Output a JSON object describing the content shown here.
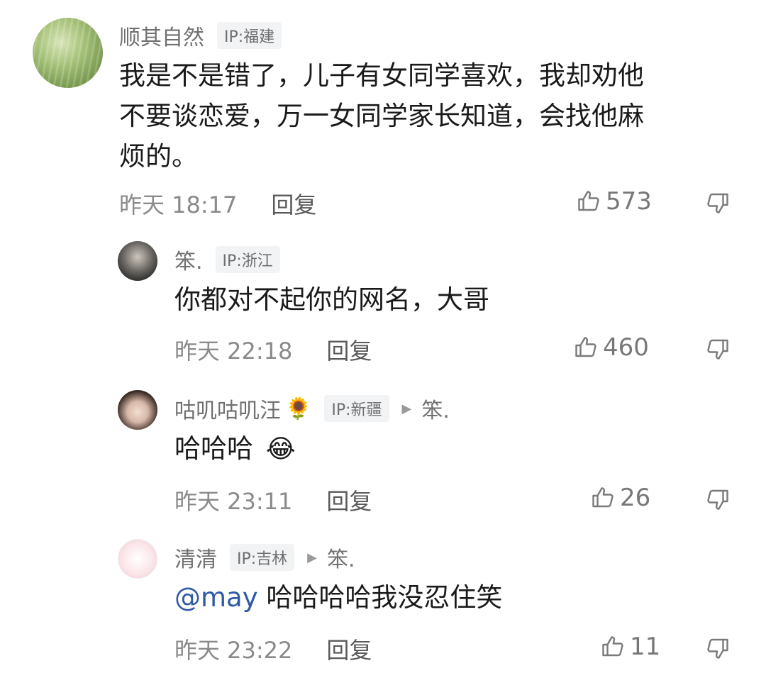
{
  "comments": [
    {
      "username": "顺其自然",
      "ip": "IP:福建",
      "lines": [
        "我是不是错了，儿子有女同学喜欢，我却劝他",
        "不要谈恋爱，万一女同学家长知道，会找他麻",
        "烦的。"
      ],
      "time": "昨天 18:17",
      "reply_label": "回复",
      "likes": "573"
    },
    {
      "username": "笨.",
      "ip": "IP:浙江",
      "text": "你都对不起你的网名，大哥",
      "time": "昨天 22:18",
      "reply_label": "回复",
      "likes": "460"
    },
    {
      "username": "咕叽咕叽汪",
      "name_emoji": "🌻",
      "ip": "IP:新疆",
      "reply_to": "笨.",
      "text": "哈哈哈",
      "text_emoji": "😂",
      "time": "昨天 23:11",
      "reply_label": "回复",
      "likes": "26"
    },
    {
      "username": "清清",
      "ip": "IP:吉林",
      "reply_to": "笨.",
      "mention": "@may",
      "text": " 哈哈哈哈我没忍住笑",
      "time": "昨天 23:22",
      "reply_label": "回复",
      "likes": "11"
    }
  ],
  "icons": {
    "like": "thumbs-up-icon",
    "dislike": "thumbs-down-icon",
    "reply_arrow": "triangle-right-icon"
  },
  "colors": {
    "mention": "#2f5aa5",
    "badge_bg": "#f2f3f5"
  }
}
